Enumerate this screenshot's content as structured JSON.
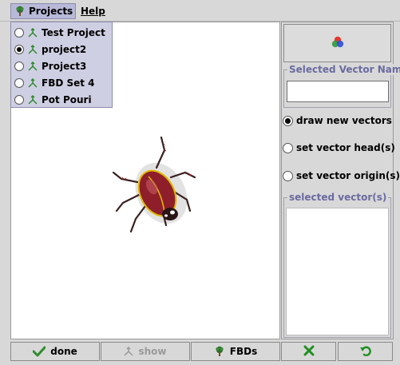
{
  "menubar": {
    "projects_label": "Projects",
    "help_label": "Help"
  },
  "projects_menu": {
    "items": [
      {
        "label": "Test Project",
        "selected": false
      },
      {
        "label": "project2",
        "selected": true
      },
      {
        "label": "Project3",
        "selected": false
      },
      {
        "label": "FBD Set 4",
        "selected": false
      },
      {
        "label": "Pot Pouri",
        "selected": false
      }
    ]
  },
  "right_panel": {
    "selected_vector_name_title": "Selected Vector Name",
    "selected_vector_name_value": "",
    "modes": [
      {
        "label": "draw new vectors",
        "selected": true
      },
      {
        "label": "set vector head(s)",
        "selected": false
      },
      {
        "label": "set vector origin(s)",
        "selected": false
      }
    ],
    "selected_vectors_title": "selected vector(s)"
  },
  "bottom_bar": {
    "done_label": "done",
    "show_label": "show",
    "fbds_label": "FBDs"
  },
  "colors": {
    "menu_highlight": "#b8b8d8",
    "group_title": "#6b6ba0",
    "vector_icon": "#2e8b2e",
    "check": "#2e8b2e",
    "cross": "#1f8f1f",
    "undo": "#1f8f1f"
  },
  "icons": {
    "projects_menu": "tree-icon",
    "vector_item": "vector-icon",
    "color_button": "color-circles-icon",
    "done": "check-icon",
    "show": "vector-icon",
    "fbds": "tree-icon",
    "delete": "cross-icon",
    "undo": "undo-icon"
  }
}
